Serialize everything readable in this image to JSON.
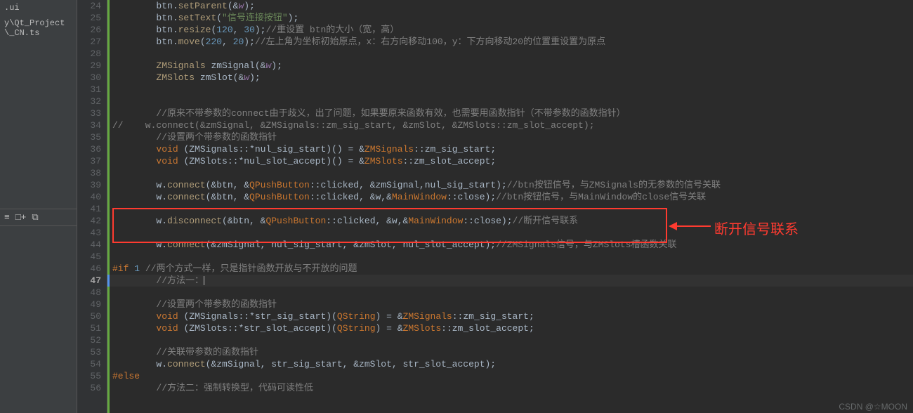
{
  "sidebar": {
    "file1": ".ui",
    "file2": "y\\Qt_Project\\_CN.ts",
    "toolbar": {
      "a": "≡",
      "b": "□+",
      "c": "⧉"
    }
  },
  "watermark": "CSDN @☆MOON",
  "annotation": "断开信号联系",
  "lines": {
    "24": [
      {
        "c": "s-def",
        "t": "        btn."
      },
      {
        "c": "s-func",
        "t": "setParent"
      },
      {
        "c": "s-def",
        "t": "(&"
      },
      {
        "c": "s-mem",
        "t": "w"
      },
      {
        "c": "s-def",
        "t": ");"
      }
    ],
    "25": [
      {
        "c": "s-def",
        "t": "        btn."
      },
      {
        "c": "s-func",
        "t": "setText"
      },
      {
        "c": "s-def",
        "t": "("
      },
      {
        "c": "s-str",
        "t": "\"信号连接按钮\""
      },
      {
        "c": "s-def",
        "t": ");"
      }
    ],
    "26": [
      {
        "c": "s-def",
        "t": "        btn."
      },
      {
        "c": "s-func",
        "t": "resize"
      },
      {
        "c": "s-def",
        "t": "("
      },
      {
        "c": "s-num",
        "t": "120"
      },
      {
        "c": "s-def",
        "t": ", "
      },
      {
        "c": "s-num",
        "t": "30"
      },
      {
        "c": "s-def",
        "t": ");"
      },
      {
        "c": "s-cmt",
        "t": "//重设置 btn的大小（宽，高）"
      }
    ],
    "27": [
      {
        "c": "s-def",
        "t": "        btn."
      },
      {
        "c": "s-func",
        "t": "move"
      },
      {
        "c": "s-def",
        "t": "("
      },
      {
        "c": "s-num",
        "t": "220"
      },
      {
        "c": "s-def",
        "t": ", "
      },
      {
        "c": "s-num",
        "t": "20"
      },
      {
        "c": "s-def",
        "t": ");"
      },
      {
        "c": "s-cmt",
        "t": "//左上角为坐标初始原点，x：右方向移动100，y：下方向移动20的位置重设置为原点"
      }
    ],
    "28": [
      {
        "c": "s-def",
        "t": ""
      }
    ],
    "29": [
      {
        "c": "s-def",
        "t": "        "
      },
      {
        "c": "s-type",
        "t": "ZMSignals"
      },
      {
        "c": "s-def",
        "t": " zmSignal(&"
      },
      {
        "c": "s-mem",
        "t": "w"
      },
      {
        "c": "s-def",
        "t": ");"
      }
    ],
    "30": [
      {
        "c": "s-def",
        "t": "        "
      },
      {
        "c": "s-type",
        "t": "ZMSlots"
      },
      {
        "c": "s-def",
        "t": " zmSlot(&"
      },
      {
        "c": "s-mem",
        "t": "w"
      },
      {
        "c": "s-def",
        "t": ");"
      }
    ],
    "31": [
      {
        "c": "s-def",
        "t": ""
      }
    ],
    "32": [
      {
        "c": "s-def",
        "t": ""
      }
    ],
    "33": [
      {
        "c": "s-def",
        "t": "        "
      },
      {
        "c": "s-cmt",
        "t": "//原来不带参数的connect由于歧义，出了问题，如果要原来函数有效，也需要用函数指针（不带参数的函数指针）"
      }
    ],
    "34": [
      {
        "c": "s-cmt",
        "t": "//    w.connect(&zmSignal, &ZMSignals::zm_sig_start, &zmSlot, &ZMSlots::zm_slot_accept);"
      }
    ],
    "35": [
      {
        "c": "s-def",
        "t": "        "
      },
      {
        "c": "s-cmt",
        "t": "//设置两个带参数的函数指针"
      }
    ],
    "36": [
      {
        "c": "s-def",
        "t": "        "
      },
      {
        "c": "s-kw",
        "t": "void"
      },
      {
        "c": "s-def",
        "t": " (ZMSignals::*nul_sig_start)() = &"
      },
      {
        "c": "s-cls",
        "t": "ZMSignals"
      },
      {
        "c": "s-def",
        "t": "::zm_sig_start;"
      }
    ],
    "37": [
      {
        "c": "s-def",
        "t": "        "
      },
      {
        "c": "s-kw",
        "t": "void"
      },
      {
        "c": "s-def",
        "t": " (ZMSlots::*nul_slot_accept)() = &"
      },
      {
        "c": "s-cls",
        "t": "ZMSlots"
      },
      {
        "c": "s-def",
        "t": "::zm_slot_accept;"
      }
    ],
    "38": [
      {
        "c": "s-def",
        "t": ""
      }
    ],
    "39": [
      {
        "c": "s-def",
        "t": "        w."
      },
      {
        "c": "s-func",
        "t": "connect"
      },
      {
        "c": "s-def",
        "t": "(&btn, &"
      },
      {
        "c": "s-cls",
        "t": "QPushButton"
      },
      {
        "c": "s-def",
        "t": "::clicked, &zmSignal,nul_sig_start);"
      },
      {
        "c": "s-cmt",
        "t": "//btn按钮信号，与ZMSignals的无参数的信号关联"
      }
    ],
    "40": [
      {
        "c": "s-def",
        "t": "        w."
      },
      {
        "c": "s-func",
        "t": "connect"
      },
      {
        "c": "s-def",
        "t": "(&btn, &"
      },
      {
        "c": "s-cls",
        "t": "QPushButton"
      },
      {
        "c": "s-def",
        "t": "::clicked, &w,&"
      },
      {
        "c": "s-cls",
        "t": "MainWindow"
      },
      {
        "c": "s-def",
        "t": "::close);"
      },
      {
        "c": "s-cmt",
        "t": "//btn按钮信号，与MainWindow的close信号关联"
      }
    ],
    "41": [
      {
        "c": "s-def",
        "t": ""
      }
    ],
    "42": [
      {
        "c": "s-def",
        "t": "        w."
      },
      {
        "c": "s-func",
        "t": "disconnect"
      },
      {
        "c": "s-def",
        "t": "(&btn, &"
      },
      {
        "c": "s-cls",
        "t": "QPushButton"
      },
      {
        "c": "s-def",
        "t": "::clicked, &w,&"
      },
      {
        "c": "s-cls",
        "t": "MainWindow"
      },
      {
        "c": "s-def",
        "t": "::close);"
      },
      {
        "c": "s-cmt",
        "t": "//断开信号联系"
      }
    ],
    "43": [
      {
        "c": "s-def",
        "t": ""
      }
    ],
    "44": [
      {
        "c": "s-def",
        "t": "        w."
      },
      {
        "c": "s-func",
        "t": "connect"
      },
      {
        "c": "s-def",
        "t": "(&zmSignal, nul_sig_start, &zmSlot, nul_slot_accept);"
      },
      {
        "c": "s-cmt",
        "t": "//ZMSignals信号，与ZMSlots槽函数关联"
      }
    ],
    "45": [
      {
        "c": "s-def",
        "t": ""
      }
    ],
    "46": [
      {
        "c": "s-kw",
        "t": "#if"
      },
      {
        "c": "s-def",
        "t": " "
      },
      {
        "c": "s-num",
        "t": "1"
      },
      {
        "c": "s-def",
        "t": " "
      },
      {
        "c": "s-cmt",
        "t": "//两个方式一样，只是指针函数开放与不开放的问题"
      }
    ],
    "47": [
      {
        "c": "s-def",
        "t": "        "
      },
      {
        "c": "s-cmt",
        "t": "//方法一："
      }
    ],
    "48": [
      {
        "c": "s-def",
        "t": ""
      }
    ],
    "49": [
      {
        "c": "s-def",
        "t": "        "
      },
      {
        "c": "s-cmt",
        "t": "//设置两个带参数的函数指针"
      }
    ],
    "50": [
      {
        "c": "s-def",
        "t": "        "
      },
      {
        "c": "s-kw",
        "t": "void"
      },
      {
        "c": "s-def",
        "t": " (ZMSignals::*str_sig_start)("
      },
      {
        "c": "s-cls",
        "t": "QString"
      },
      {
        "c": "s-def",
        "t": ") = &"
      },
      {
        "c": "s-cls",
        "t": "ZMSignals"
      },
      {
        "c": "s-def",
        "t": "::zm_sig_start;"
      }
    ],
    "51": [
      {
        "c": "s-def",
        "t": "        "
      },
      {
        "c": "s-kw",
        "t": "void"
      },
      {
        "c": "s-def",
        "t": " (ZMSlots::*str_slot_accept)("
      },
      {
        "c": "s-cls",
        "t": "QString"
      },
      {
        "c": "s-def",
        "t": ") = &"
      },
      {
        "c": "s-cls",
        "t": "ZMSlots"
      },
      {
        "c": "s-def",
        "t": "::zm_slot_accept;"
      }
    ],
    "52": [
      {
        "c": "s-def",
        "t": ""
      }
    ],
    "53": [
      {
        "c": "s-def",
        "t": "        "
      },
      {
        "c": "s-cmt",
        "t": "//关联带参数的函数指针"
      }
    ],
    "54": [
      {
        "c": "s-def",
        "t": "        w."
      },
      {
        "c": "s-func",
        "t": "connect"
      },
      {
        "c": "s-def",
        "t": "(&zmSignal, str_sig_start, &zmSlot, str_slot_accept);"
      }
    ],
    "55": [
      {
        "c": "s-kw",
        "t": "#else"
      }
    ],
    "56": [
      {
        "c": "s-def",
        "t": "        "
      },
      {
        "c": "s-cmt",
        "t": "//方法二：强制转换型，代码可读性低"
      }
    ]
  },
  "first_line": 24,
  "last_line": 56,
  "current_line": 47
}
